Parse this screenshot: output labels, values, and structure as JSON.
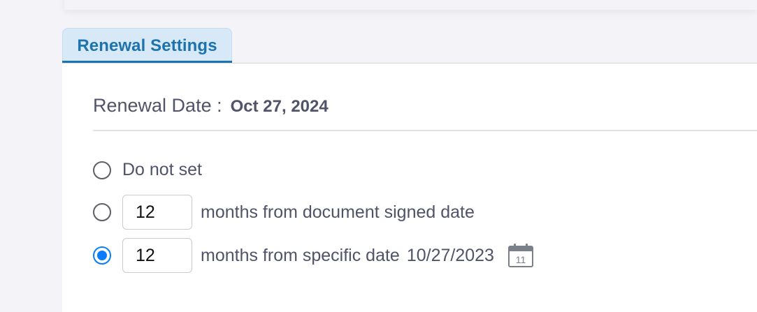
{
  "tab": {
    "label": "Renewal Settings"
  },
  "renewal": {
    "label": "Renewal Date :",
    "value": "Oct 27, 2024"
  },
  "options": [
    {
      "label": "Do not set",
      "checked": false
    },
    {
      "label": "months from document signed date",
      "months": "12",
      "checked": false
    },
    {
      "label": "months from specific date",
      "months": "12",
      "date": "10/27/2023",
      "calendar_day": "11",
      "checked": true
    }
  ],
  "icons": {
    "calendar": "calendar-icon"
  },
  "colors": {
    "accent": "#1d73ad",
    "radio_selected": "#0a7cff",
    "tab_bg": "#d7e8f6",
    "text": "#4f5468"
  }
}
